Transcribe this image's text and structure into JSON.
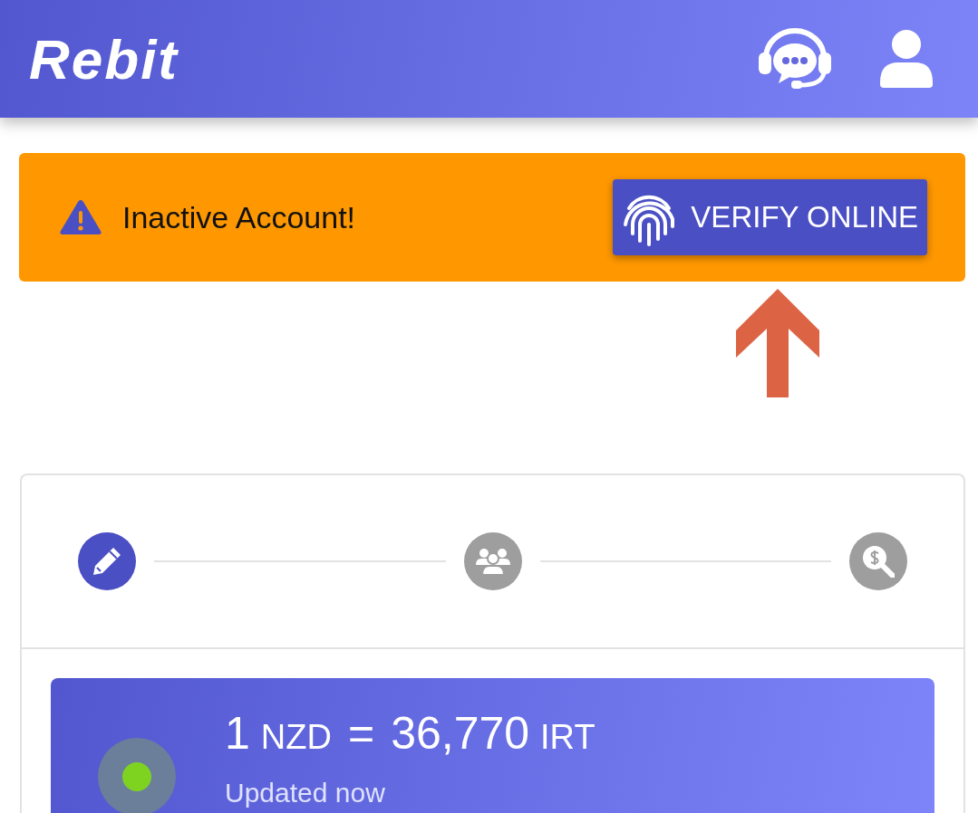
{
  "header": {
    "logo": "Rebit"
  },
  "alert": {
    "message": "Inactive Account!",
    "button": "VERIFY ONLINE"
  },
  "steps": [
    {
      "kind": "edit",
      "selected": true
    },
    {
      "kind": "people",
      "selected": false
    },
    {
      "kind": "search-money",
      "selected": false
    }
  ],
  "rate": {
    "live": true,
    "base_amount": "1",
    "base_currency": "NZD",
    "equals": "=",
    "quote_amount": "36,770",
    "quote_currency": "IRT",
    "updated": "Updated now"
  }
}
